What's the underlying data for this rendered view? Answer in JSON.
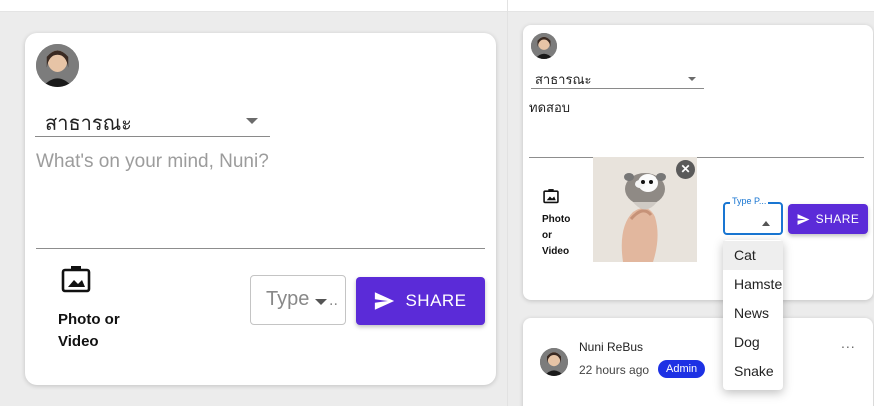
{
  "left_composer": {
    "privacy_value": "สาธารณะ",
    "placeholder": "What's on your mind, Nuni?",
    "photo_label_line1": "Photo or",
    "photo_label_line2": "Video",
    "type_select_text": "Type",
    "share_label": "SHARE"
  },
  "right_composer": {
    "privacy_value": "สาธารณะ",
    "post_text": "ทดสอบ",
    "photo_label_line1": "Photo",
    "photo_label_line2": "or",
    "photo_label_line3": "Video",
    "type_legend": "Type P...",
    "share_label": "SHARE",
    "type_options": [
      "Cat",
      "Hamster",
      "News",
      "Dog",
      "Snake"
    ]
  },
  "feed_post": {
    "author": "Nuni ReBus",
    "time": "22 hours ago",
    "badge": "Admin",
    "more": "..."
  },
  "icons": {
    "photo": "photo-frame-icon",
    "send": "send-icon",
    "close": "close-circle-icon",
    "caret": "caret-down-icon",
    "more": "more-horizontal-icon"
  },
  "colors": {
    "accent": "#5b2bd8",
    "badge": "#1d31e4",
    "focus": "#1976d2"
  }
}
